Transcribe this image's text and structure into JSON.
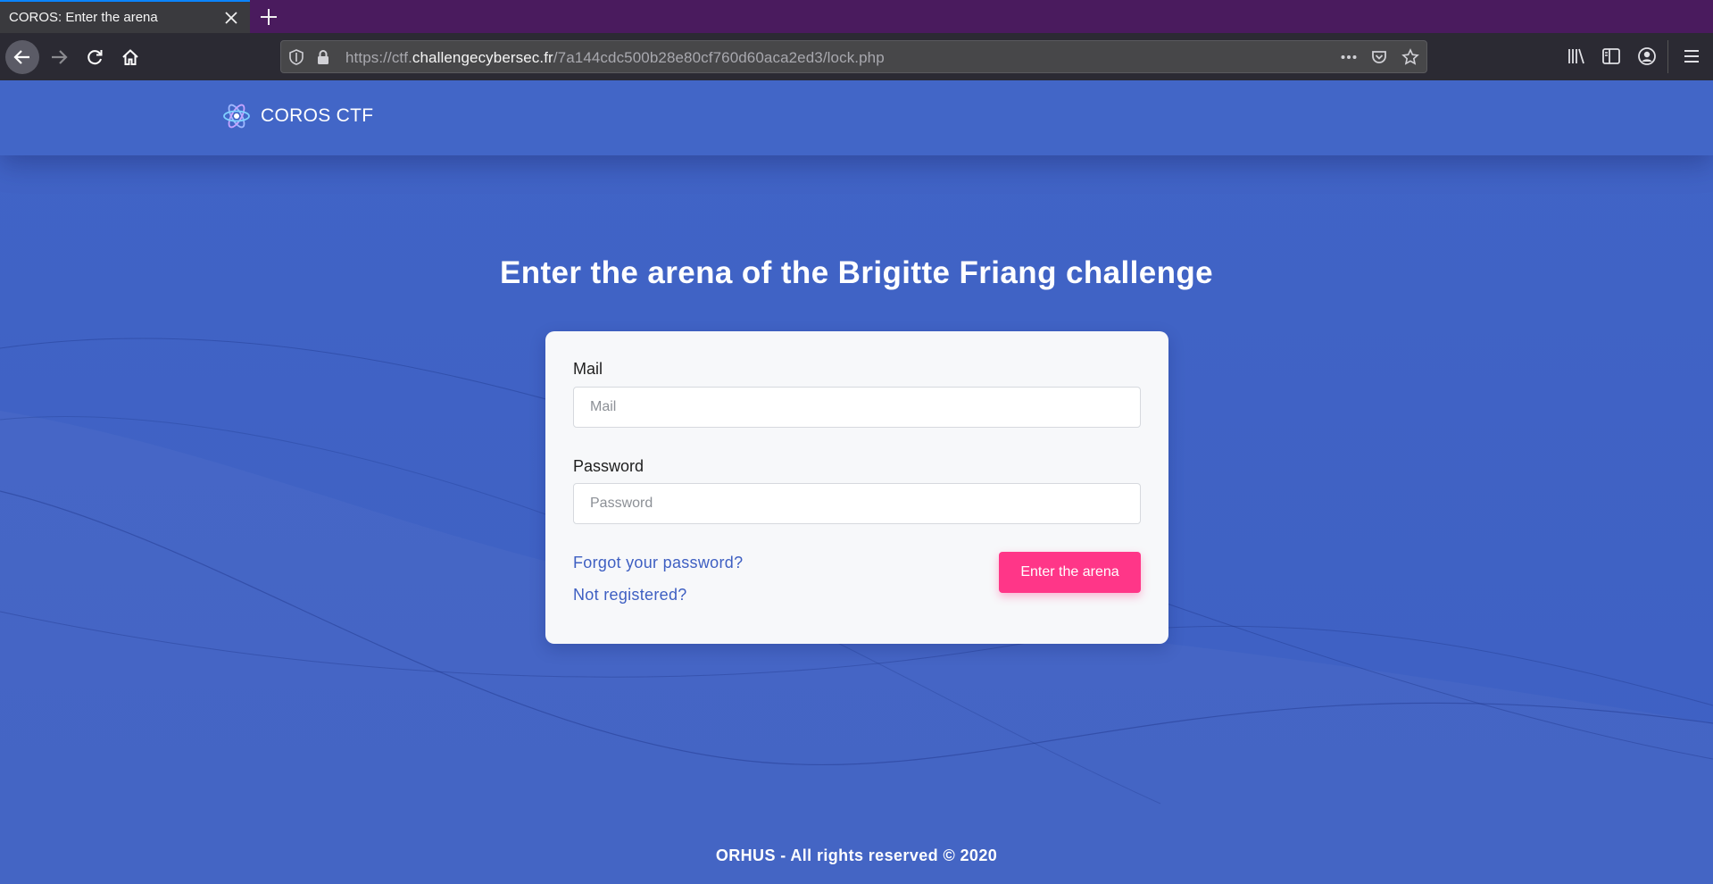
{
  "browser": {
    "tab_title": "COROS: Enter the arena",
    "url_prefix": "https://ctf.",
    "url_host": "challengecybersec.fr",
    "url_path": "/7a144cdc500b28e80cf760d60aca2ed3/lock.php",
    "tabbar_color": "#4a1b5e"
  },
  "header": {
    "brand": "COROS CTF",
    "logo_icon": "atom-icon"
  },
  "main": {
    "headline": "Enter the arena of the Brigitte Friang challenge"
  },
  "form": {
    "mail_label": "Mail",
    "mail_placeholder": "Mail",
    "mail_value": "",
    "password_label": "Password",
    "password_placeholder": "Password",
    "password_value": "",
    "forgot_link": "Forgot your password?",
    "register_link": "Not registered?",
    "submit_label": "Enter the arena",
    "submit_color": "#ff3688"
  },
  "footer": {
    "text": "ORHUS - All rights reserved © 2020"
  },
  "colors": {
    "page_background": "#3f62c4",
    "card_background": "#f7f8fa",
    "link": "#3e5fc2"
  }
}
